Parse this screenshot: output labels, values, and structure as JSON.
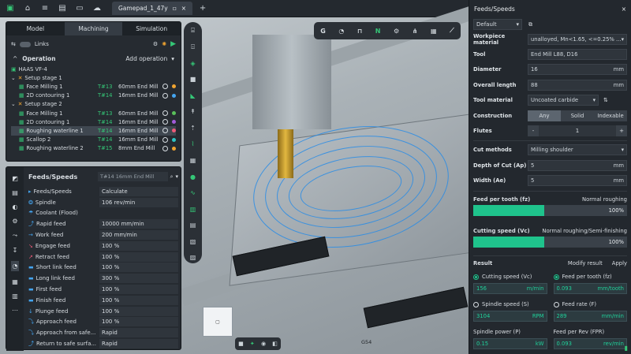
{
  "toolbar": {
    "tab_title": "Gamepad_1_47y"
  },
  "viewport": {
    "labels": [
      "G54"
    ]
  },
  "left_panel": {
    "tabs": [
      "Model",
      "Machining",
      "Simulation"
    ],
    "links_label": "Links",
    "operation_label": "Operation",
    "add_operation": "Add operation",
    "tree": [
      {
        "name": "HAAS VF-4",
        "tool": "",
        "desc": "",
        "dot": ""
      },
      {
        "name": "Setup stage 1",
        "tool": "",
        "desc": "",
        "dot": ""
      },
      {
        "name": "Face Milling 1",
        "tool": "T#13",
        "desc": "60mm End Mill",
        "dot": "#f0a431"
      },
      {
        "name": "2D contouring 1",
        "tool": "T#14",
        "desc": "16mm End Mill",
        "dot": "#44a5f0"
      },
      {
        "name": "Setup stage 2",
        "tool": "",
        "desc": "",
        "dot": ""
      },
      {
        "name": "Face Milling 1",
        "tool": "T#13",
        "desc": "60mm End Mill",
        "dot": "#59c05a"
      },
      {
        "name": "2D contouring 1",
        "tool": "T#14",
        "desc": "16mm End Mill",
        "dot": "#a25ad8"
      },
      {
        "name": "Roughing waterline 1",
        "tool": "T#14",
        "desc": "16mm End Mill",
        "dot": "#f05a78"
      },
      {
        "name": "Scallop 2",
        "tool": "T#14",
        "desc": "16mm End Mill",
        "dot": "#2ec3c3"
      },
      {
        "name": "Roughing waterline 2",
        "tool": "T#15",
        "desc": "8mm End Mill",
        "dot": "#f0a431"
      }
    ]
  },
  "feeds_panel": {
    "title": "Feeds/Speeds",
    "tool_hint": "T#14  16mm End Mill",
    "rows": [
      {
        "k": "Feeds/Speeds",
        "v": "Calculate"
      },
      {
        "k": "Spindle",
        "v": "106 rev/min"
      },
      {
        "k": "Coolant  (Flood)",
        "v": ""
      },
      {
        "k": "Rapid feed",
        "v": "10000 mm/min"
      },
      {
        "k": "Work feed",
        "v": "200 mm/min"
      },
      {
        "k": "Engage feed",
        "v": "100 %"
      },
      {
        "k": "Retract feed",
        "v": "100 %"
      },
      {
        "k": "Short link feed",
        "v": "100 %"
      },
      {
        "k": "Long link feed",
        "v": "300 %"
      },
      {
        "k": "First feed",
        "v": "100 %"
      },
      {
        "k": "Finish feed",
        "v": "100 %"
      },
      {
        "k": "Plunge feed",
        "v": "100 %"
      },
      {
        "k": "Approach feed",
        "v": "100 %"
      },
      {
        "k": "Approach from safe...",
        "v": "Rapid"
      },
      {
        "k": "Return to safe surfa...",
        "v": "Rapid"
      }
    ]
  },
  "right_panel": {
    "title": "Feeds/Speeds",
    "preset": "Default",
    "workpiece_label": "Workpiece material",
    "workpiece_value": "unalloyed,  Mn<1.65, <=0.25% ...",
    "tool_label": "Tool",
    "tool_value": "End Mill L88, D16",
    "diameter_label": "Diameter",
    "diameter_value": "16",
    "diameter_unit": "mm",
    "overall_label": "Overall length",
    "overall_value": "88",
    "overall_unit": "mm",
    "toolmat_label": "Tool material",
    "toolmat_value": "Uncoated carbide",
    "construction_label": "Construction",
    "construction_opts": [
      "Any",
      "Solid",
      "Indexable"
    ],
    "flutes_label": "Flutes",
    "flutes_value": "1",
    "cut_label": "Cut methods",
    "cut_value": "Milling shoulder",
    "doc_label": "Depth of Cut (Ap)",
    "doc_value": "5",
    "doc_unit": "mm",
    "width_label": "Width (Ae)",
    "width_value": "5",
    "width_unit": "mm",
    "fz_label": "Feed per tooth (fz)",
    "fz_mode": "Normal roughing",
    "fz_pct": "100%",
    "fz_fill": 0.46,
    "vc_label": "Cutting speed (Vc)",
    "vc_mode": "Normal roughing/Semi-finishing",
    "vc_pct": "100%",
    "vc_fill": 0.46,
    "result_label": "Result",
    "modify_label": "Modify result",
    "apply_label": "Apply",
    "results": [
      {
        "label": "Cutting speed (Vc)",
        "value": "156",
        "unit": "m/min",
        "on": true
      },
      {
        "label": "Feed per tooth (fz)",
        "value": "0.093",
        "unit": "mm/tooth",
        "on": true
      },
      {
        "label": "Spindle speed (S)",
        "value": "3104",
        "unit": "RPM",
        "on": false
      },
      {
        "label": "Feed rate (F)",
        "value": "289",
        "unit": "mm/min",
        "on": false
      },
      {
        "label": "Spindle power (P)",
        "value": "0.15",
        "unit": "kW",
        "on": false
      },
      {
        "label": "Feed per Rev (FPR)",
        "value": "0.093",
        "unit": "rev/min",
        "on": false
      }
    ]
  }
}
